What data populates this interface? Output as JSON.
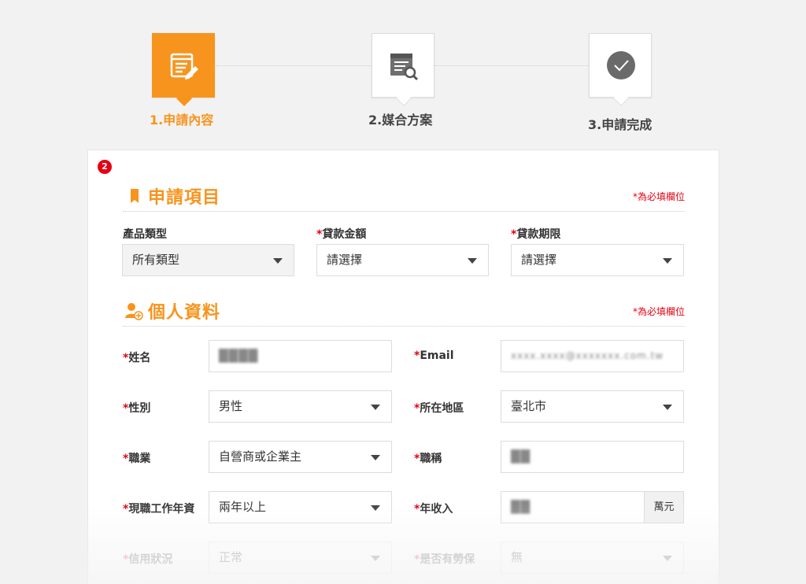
{
  "stepper": {
    "steps": [
      {
        "label": "1.申請內容",
        "state": "active",
        "icon": "form-edit-icon"
      },
      {
        "label": "2.媒合方案",
        "state": "inactive",
        "icon": "document-search-icon"
      },
      {
        "label": "3.申請完成",
        "state": "inactive",
        "icon": "check-circle-icon"
      }
    ],
    "active_color": "#f7941d"
  },
  "card": {
    "badge": "2",
    "application_section": {
      "title": "申請項目",
      "icon": "bookmark-icon",
      "required_note": "*為必填欄位",
      "fields": [
        {
          "label": "產品類型",
          "required": false,
          "value": "所有類型",
          "type": "select"
        },
        {
          "label": "貸款金額",
          "required": true,
          "value": "請選擇",
          "type": "select"
        },
        {
          "label": "貸款期限",
          "required": true,
          "value": "請選擇",
          "type": "select"
        }
      ]
    },
    "personal_section": {
      "title": "個人資料",
      "icon": "user-add-icon",
      "required_note": "*為必填欄位",
      "fields": {
        "name": {
          "label": "姓名",
          "value": "████",
          "type": "input"
        },
        "email": {
          "label": "Email",
          "value": "xxxx.xxxx@xxxxxxx.com.tw",
          "type": "input"
        },
        "gender": {
          "label": "性別",
          "value": "男性",
          "type": "select"
        },
        "region": {
          "label": "所在地區",
          "value": "臺北市",
          "type": "select"
        },
        "occupation": {
          "label": "職業",
          "value": "自營商或企業主",
          "type": "select"
        },
        "job_title": {
          "label": "職稱",
          "value": "██",
          "type": "input"
        },
        "seniority": {
          "label": "現職工作年資",
          "value": "兩年以上",
          "type": "select"
        },
        "income": {
          "label": "年收入",
          "value": "██",
          "addon": "萬元",
          "type": "input"
        },
        "credit": {
          "label": "信用狀況",
          "value": "正常",
          "type": "select"
        },
        "labor_insurance": {
          "label": "是否有勞保",
          "value": "無",
          "type": "select"
        }
      },
      "required_mark": "*"
    }
  },
  "colors": {
    "accent": "#f7941d",
    "required": "#e50012"
  }
}
